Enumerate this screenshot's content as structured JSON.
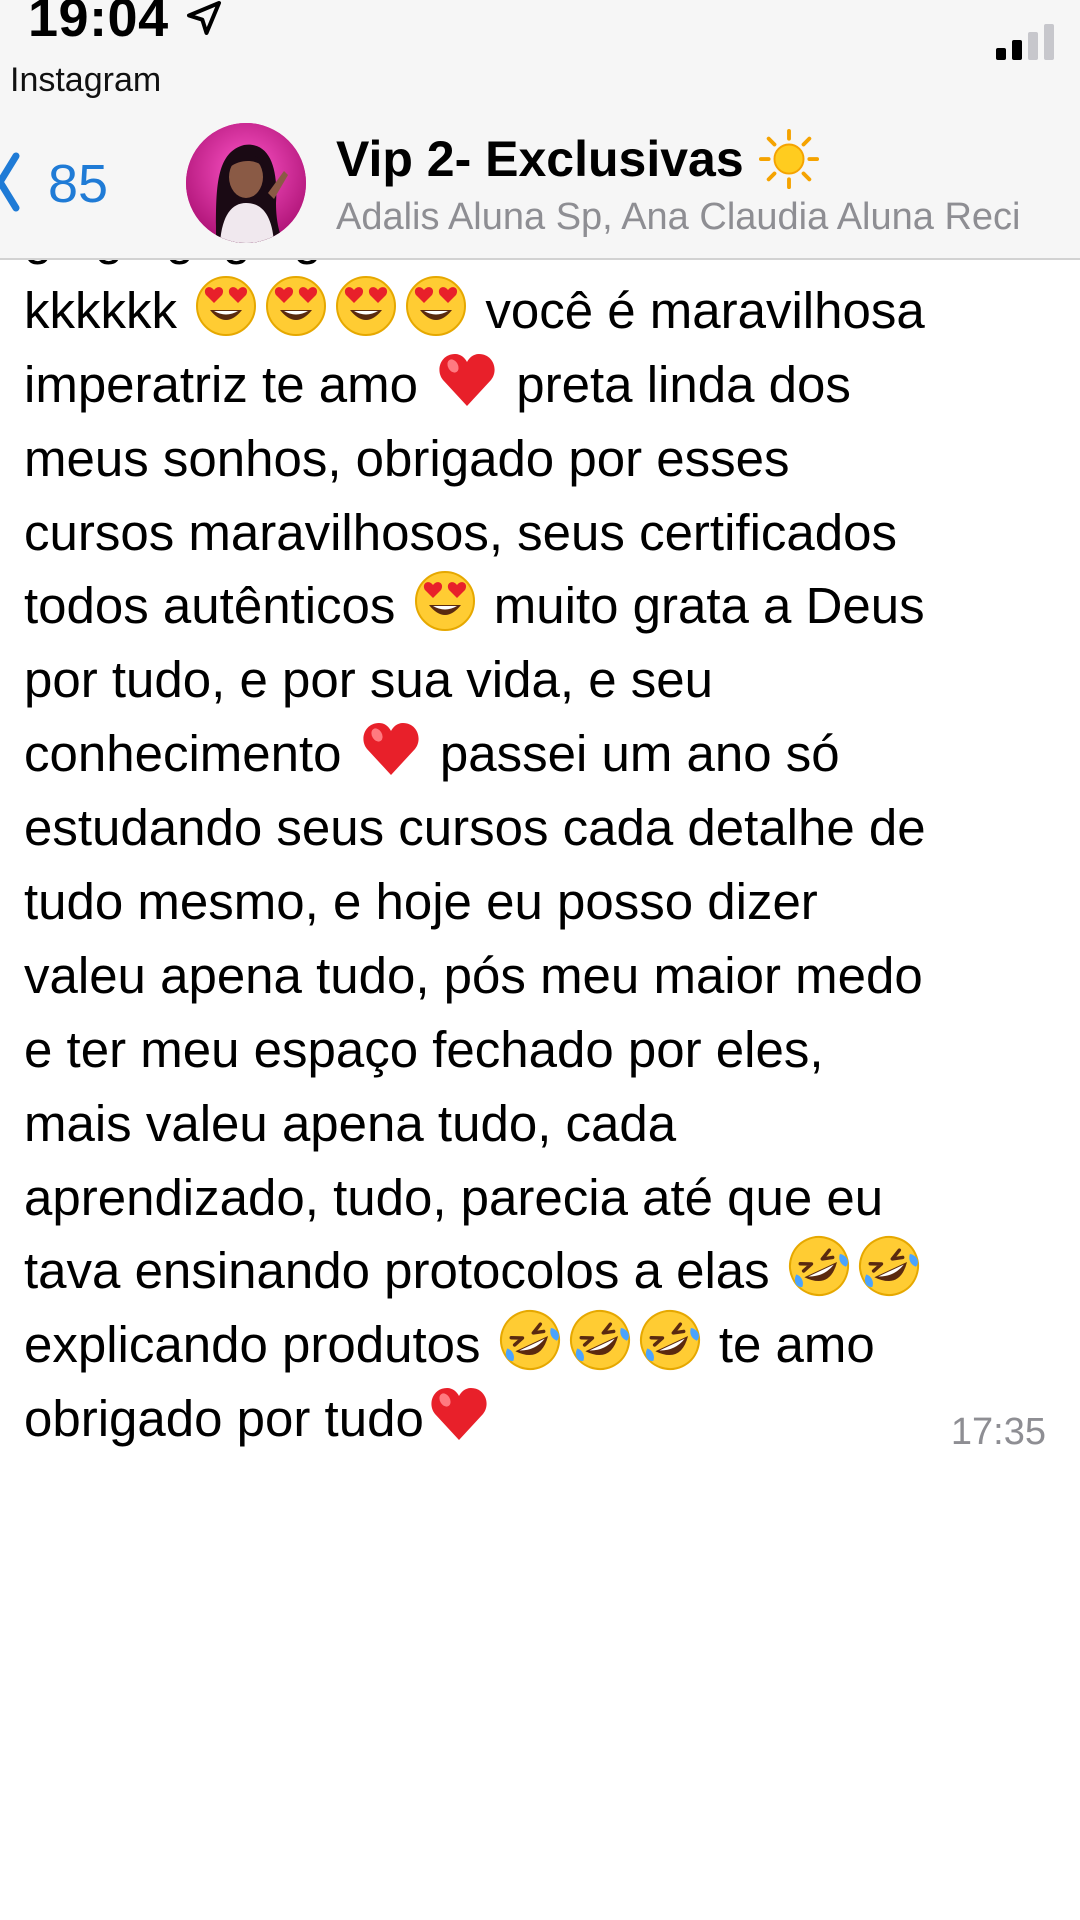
{
  "status_bar": {
    "time": "19:04",
    "back_app": "Instagram",
    "location_icon": "location-arrow-icon",
    "signal_icon": "cellular-signal-icon"
  },
  "chat": {
    "back_count": "85",
    "title": "Vip 2- Exclusivas",
    "title_emoji": "sun-icon",
    "members": "Adalis Aluna Sp, Ana Claudia Aluna Reci"
  },
  "message": {
    "lines": [
      "ga ga gaga ga",
      "kkkkkk [heart-eyes][heart-eyes][heart-eyes][heart-eyes] você é maravilhosa",
      "imperatriz te amo [heart] preta linda dos",
      "meus sonhos, obrigado por esses",
      "cursos maravilhosos, seus certificados",
      "todos autênticos [heart-eyes] muito grata a Deus",
      "por tudo, e por sua vida, e seu",
      "conhecimento [heart] passei um ano só",
      "estudando seus cursos cada detalhe de",
      "tudo mesmo, e hoje eu posso dizer",
      "valeu apena tudo, pós meu maior medo",
      "e ter meu espaço fechado por eles,",
      "mais valeu apena tudo, cada",
      "aprendizado, tudo, parecia até que eu",
      "tava ensinando protocolos a elas [rofl][rofl]",
      "explicando produtos [rofl][rofl][rofl] te amo",
      "obrigado por tudo[heart]"
    ],
    "time": "17:35"
  },
  "colors": {
    "header_bg": "#f6f6f6",
    "accent": "#1f7bd6",
    "secondary_text": "#8e8e93"
  }
}
